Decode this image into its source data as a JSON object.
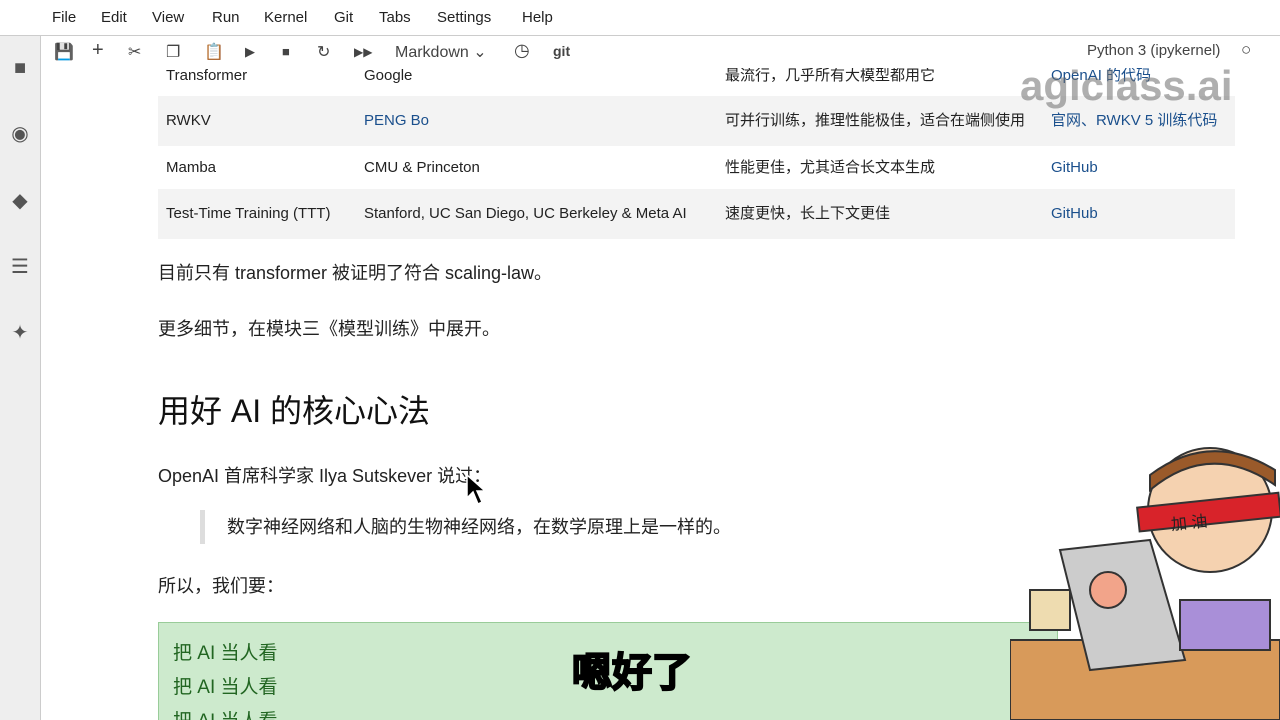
{
  "menu": [
    "File",
    "Edit",
    "View",
    "Run",
    "Kernel",
    "Git",
    "Tabs",
    "Settings",
    "Help"
  ],
  "toolbar": {
    "cell_type": "Markdown",
    "git_label": "git",
    "kernel": "Python 3 (ipykernel)"
  },
  "table": {
    "rows": [
      [
        "Transformer",
        "Google",
        "最流行，几乎所有大模型都用它",
        "OpenAI 的代码"
      ],
      [
        "RWKV",
        "PENG Bo",
        "可并行训练，推理性能极佳，适合在端侧使用",
        "官网、RWKV 5 训练代码"
      ],
      [
        "Mamba",
        "CMU & Princeton",
        "性能更佳，尤其适合长文本生成",
        "GitHub"
      ],
      [
        "Test-Time Training (TTT)",
        "Stanford, UC San Diego, UC Berkeley & Meta AI",
        "速度更快，长上下文更佳",
        "GitHub"
      ]
    ]
  },
  "p1": "目前只有 transformer 被证明了符合 scaling-law。",
  "p2": "更多细节，在模块三《模型训练》中展开。",
  "heading": "用好 AI 的核心心法",
  "p3": "OpenAI 首席科学家 Ilya Sutskever 说过：",
  "quote": "数字神经网络和人脑的生物神经网络，在数学原理上是一样的。",
  "p4": "所以，我们要：",
  "green": [
    "把 AI 当人看",
    "把 AI 当人看",
    "把 AI 当人看"
  ],
  "watermark": "agiclass.ai",
  "subtitle": "嗯好了",
  "headband": "加油"
}
